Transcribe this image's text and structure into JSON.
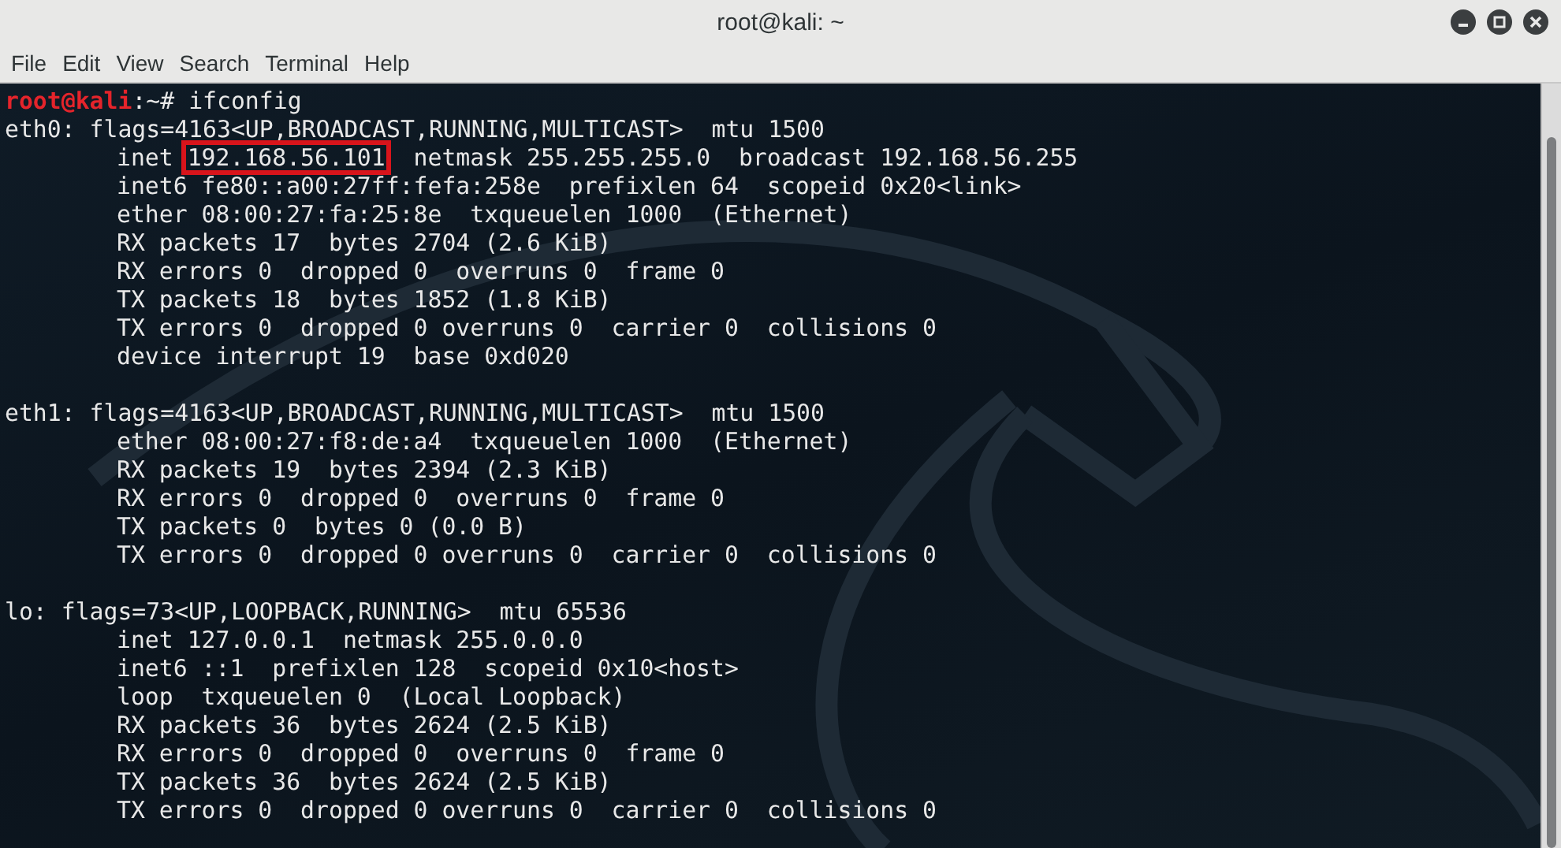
{
  "window": {
    "title": "root@kali: ~"
  },
  "menu": [
    "File",
    "Edit",
    "View",
    "Search",
    "Terminal",
    "Help"
  ],
  "prompt": {
    "user_host": "root@kali",
    "path": ":~# ",
    "command": "ifconfig"
  },
  "output_blocks": [
    {
      "lines": [
        {
          "indented": false,
          "segments": [
            {
              "text": "eth0: flags=4163<UP,BROADCAST,RUNNING,MULTICAST>  mtu 1500",
              "boxed": false
            }
          ]
        },
        {
          "indented": true,
          "segments": [
            {
              "text": "inet ",
              "boxed": false
            },
            {
              "text": "192.168.56.101",
              "boxed": true
            },
            {
              "text": "  netmask 255.255.255.0  broadcast 192.168.56.255",
              "boxed": false
            }
          ]
        },
        {
          "indented": true,
          "segments": [
            {
              "text": "inet6 fe80::a00:27ff:fefa:258e  prefixlen 64  scopeid 0x20<link>",
              "boxed": false
            }
          ]
        },
        {
          "indented": true,
          "segments": [
            {
              "text": "ether 08:00:27:fa:25:8e  txqueuelen 1000  (Ethernet)",
              "boxed": false
            }
          ]
        },
        {
          "indented": true,
          "segments": [
            {
              "text": "RX packets 17  bytes 2704 (2.6 KiB)",
              "boxed": false
            }
          ]
        },
        {
          "indented": true,
          "segments": [
            {
              "text": "RX errors 0  dropped 0  overruns 0  frame 0",
              "boxed": false
            }
          ]
        },
        {
          "indented": true,
          "segments": [
            {
              "text": "TX packets 18  bytes 1852 (1.8 KiB)",
              "boxed": false
            }
          ]
        },
        {
          "indented": true,
          "segments": [
            {
              "text": "TX errors 0  dropped 0 overruns 0  carrier 0  collisions 0",
              "boxed": false
            }
          ]
        },
        {
          "indented": true,
          "segments": [
            {
              "text": "device interrupt 19  base 0xd020",
              "boxed": false
            }
          ]
        }
      ]
    },
    {
      "lines": [
        {
          "indented": false,
          "segments": [
            {
              "text": "eth1: flags=4163<UP,BROADCAST,RUNNING,MULTICAST>  mtu 1500",
              "boxed": false
            }
          ]
        },
        {
          "indented": true,
          "segments": [
            {
              "text": "ether 08:00:27:f8:de:a4  txqueuelen 1000  (Ethernet)",
              "boxed": false
            }
          ]
        },
        {
          "indented": true,
          "segments": [
            {
              "text": "RX packets 19  bytes 2394 (2.3 KiB)",
              "boxed": false
            }
          ]
        },
        {
          "indented": true,
          "segments": [
            {
              "text": "RX errors 0  dropped 0  overruns 0  frame 0",
              "boxed": false
            }
          ]
        },
        {
          "indented": true,
          "segments": [
            {
              "text": "TX packets 0  bytes 0 (0.0 B)",
              "boxed": false
            }
          ]
        },
        {
          "indented": true,
          "segments": [
            {
              "text": "TX errors 0  dropped 0 overruns 0  carrier 0  collisions 0",
              "boxed": false
            }
          ]
        }
      ]
    },
    {
      "lines": [
        {
          "indented": false,
          "segments": [
            {
              "text": "lo: flags=73<UP,LOOPBACK,RUNNING>  mtu 65536",
              "boxed": false
            }
          ]
        },
        {
          "indented": true,
          "segments": [
            {
              "text": "inet 127.0.0.1  netmask 255.0.0.0",
              "boxed": false
            }
          ]
        },
        {
          "indented": true,
          "segments": [
            {
              "text": "inet6 ::1  prefixlen 128  scopeid 0x10<host>",
              "boxed": false
            }
          ]
        },
        {
          "indented": true,
          "segments": [
            {
              "text": "loop  txqueuelen 0  (Local Loopback)",
              "boxed": false
            }
          ]
        },
        {
          "indented": true,
          "segments": [
            {
              "text": "RX packets 36  bytes 2624 (2.5 KiB)",
              "boxed": false
            }
          ]
        },
        {
          "indented": true,
          "segments": [
            {
              "text": "RX errors 0  dropped 0  overruns 0  frame 0",
              "boxed": false
            }
          ]
        },
        {
          "indented": true,
          "segments": [
            {
              "text": "TX packets 36  bytes 2624 (2.5 KiB)",
              "boxed": false
            }
          ]
        },
        {
          "indented": true,
          "segments": [
            {
              "text": "TX errors 0  dropped 0 overruns 0  carrier 0  collisions 0",
              "boxed": false
            }
          ]
        }
      ]
    }
  ]
}
